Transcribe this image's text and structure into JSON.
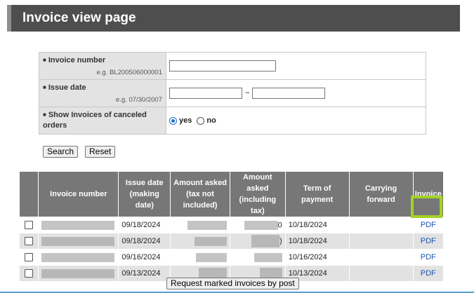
{
  "page": {
    "title": "Invoice view page"
  },
  "search": {
    "invoice_number": {
      "label": "Invoice number",
      "example": "e.g. BL200506000001",
      "value": ""
    },
    "issue_date": {
      "label": "Issue date",
      "example": "e.g. 07/30/2007",
      "from_value": "",
      "to_value": "",
      "separator": "~"
    },
    "canceled": {
      "label": "Show Invoices of canceled orders",
      "options": [
        "yes",
        "no"
      ],
      "selected": "yes"
    },
    "search_button": "Search",
    "reset_button": "Reset"
  },
  "invoices": {
    "headers": {
      "invoice_number": "Invoice number",
      "issue_date_l1": "Issue date",
      "issue_date_l2": "(making date)",
      "amount_no_tax_l1": "Amount asked",
      "amount_no_tax_l2": "(tax not included)",
      "amount_tax_l1": "Amount asked",
      "amount_tax_l2": "(including tax)",
      "term": "Term of payment",
      "carrying": "Carrying forward",
      "invoice": "Invoice"
    },
    "rows": [
      {
        "issue_date": "09/18/2024",
        "amount_tax_suffix": "0",
        "term": "10/18/2024",
        "carrying": "",
        "invoice": "PDF"
      },
      {
        "issue_date": "09/18/2024",
        "amount_tax_suffix": ")",
        "term": "10/18/2024",
        "carrying": "",
        "invoice": "PDF"
      },
      {
        "issue_date": "09/16/2024",
        "amount_tax_suffix": "",
        "term": "10/16/2024",
        "carrying": "",
        "invoice": "PDF"
      },
      {
        "issue_date": "09/13/2024",
        "amount_tax_suffix": "",
        "term": "10/13/2024",
        "carrying": "",
        "invoice": "PDF"
      }
    ]
  },
  "request_button": "Request marked invoices by post",
  "colors": {
    "header_bar": "#4e4e4e",
    "table_header": "#777777",
    "highlight": "#a3d323",
    "link": "#1a53b3"
  }
}
